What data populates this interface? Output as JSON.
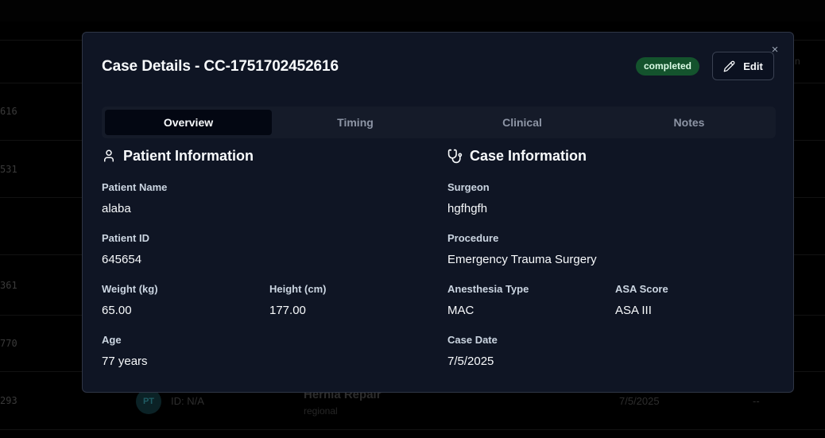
{
  "background": {
    "row_ids": [
      "616",
      "531",
      "361",
      "770",
      "293"
    ],
    "last_row": {
      "avatar_initials": "PT",
      "patient_id": "ID: N/A",
      "procedure": "Hernia Repair",
      "anesthesia": "regional",
      "date": "7/5/2025",
      "dash": "--"
    },
    "header_hint": "n"
  },
  "modal": {
    "title": "Case Details - CC-1751702452616",
    "status": "completed",
    "edit_label": "Edit",
    "close_glyph": "×",
    "colors": {
      "status_bg": "#14532d",
      "status_text": "#dcfce7",
      "panel_bg": "#0f1524"
    },
    "tabs": [
      {
        "label": "Overview",
        "active": true
      },
      {
        "label": "Timing",
        "active": false
      },
      {
        "label": "Clinical",
        "active": false
      },
      {
        "label": "Notes",
        "active": false
      }
    ],
    "patient": {
      "title": "Patient Information",
      "icon": "user-icon",
      "name": {
        "label": "Patient Name",
        "value": "alaba"
      },
      "id": {
        "label": "Patient ID",
        "value": "645654"
      },
      "weight": {
        "label": "Weight (kg)",
        "value": "65.00"
      },
      "height": {
        "label": "Height (cm)",
        "value": "177.00"
      },
      "age": {
        "label": "Age",
        "value": "77 years"
      }
    },
    "case": {
      "title": "Case Information",
      "icon": "stethoscope-icon",
      "surgeon": {
        "label": "Surgeon",
        "value": "hgfhgfh"
      },
      "procedure": {
        "label": "Procedure",
        "value": "Emergency Trauma Surgery"
      },
      "anesthesia": {
        "label": "Anesthesia Type",
        "value": "MAC"
      },
      "asa": {
        "label": "ASA Score",
        "value": "ASA III"
      },
      "date": {
        "label": "Case Date",
        "value": "7/5/2025"
      }
    }
  }
}
